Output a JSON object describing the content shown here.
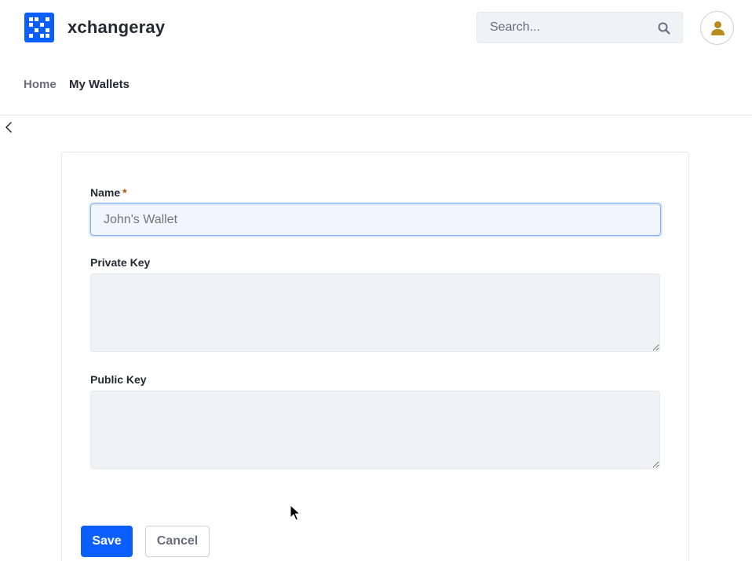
{
  "header": {
    "site_title": "xchangeray",
    "search": {
      "placeholder": "Search...",
      "value": ""
    }
  },
  "nav": {
    "items": [
      {
        "label": "Home"
      },
      {
        "label": "My Wallets"
      }
    ]
  },
  "form": {
    "name": {
      "label": "Name",
      "required_marker": "*",
      "placeholder": "John's Wallet",
      "value": ""
    },
    "private_key": {
      "label": "Private Key",
      "value": ""
    },
    "public_key": {
      "label": "Public Key",
      "value": ""
    },
    "save_label": "Save",
    "cancel_label": "Cancel"
  },
  "colors": {
    "brand": "#0b5fff",
    "avatar_icon": "#b88a1f",
    "required": "#b95000"
  },
  "icons": [
    "logo-icon",
    "search-icon",
    "user-icon",
    "back-arrow-icon",
    "mouse-cursor-icon"
  ]
}
